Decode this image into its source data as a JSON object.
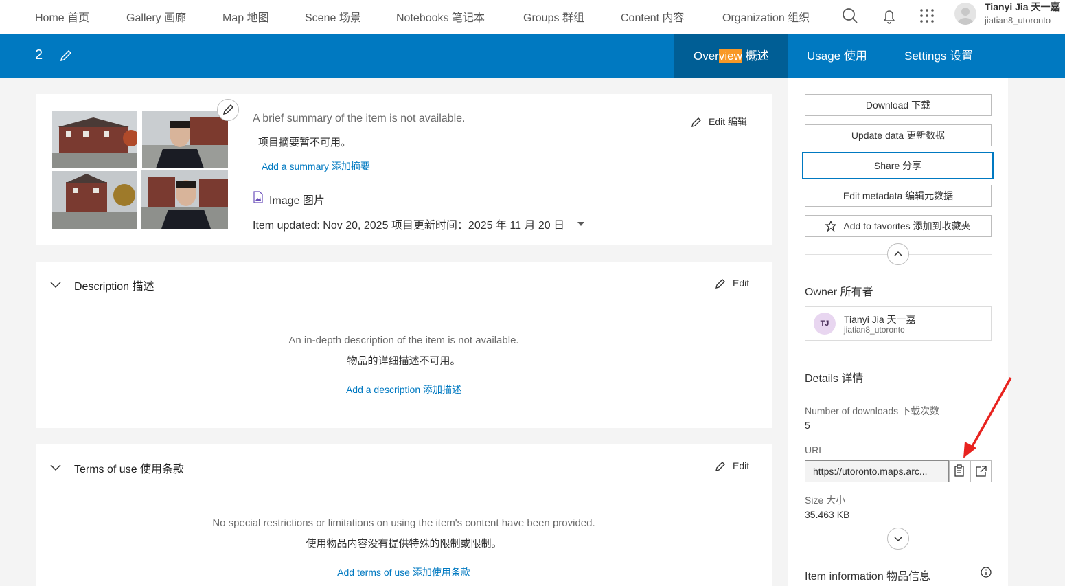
{
  "topnav": {
    "items": [
      {
        "label": "Home  首页"
      },
      {
        "label": "Gallery  画廊"
      },
      {
        "label": "Map  地图"
      },
      {
        "label": "Scene  场景"
      },
      {
        "label": "Notebooks  笔记本"
      },
      {
        "label": "Groups  群组"
      },
      {
        "label": "Content  内容"
      },
      {
        "label": "Organization  组织"
      }
    ],
    "icons": [
      "search-icon",
      "bell-icon",
      "apps-grid-icon"
    ],
    "user": {
      "name": "Tianyi Jia  天一嘉",
      "handle": "jiatian8_utoronto"
    }
  },
  "itembar": {
    "title": "2",
    "tabs": [
      {
        "label_a": "Over",
        "label_hl": "view",
        "label_b": "  概述"
      },
      {
        "label": "Usage  使用"
      },
      {
        "label": "Settings  设置"
      }
    ]
  },
  "summary_card": {
    "summary_en": "A brief summary of the item is not available.",
    "summary_zh": "项目摘要暂不可用。",
    "add_summary": "Add a summary  添加摘要",
    "item_type": "Image  图片",
    "updated": "Item updated: Nov 20, 2025  项目更新时间：2025 年 11 月 20 日",
    "edit_label": "Edit  编辑"
  },
  "description": {
    "title": "Description  描述",
    "edit": "Edit",
    "empty_en": "An in-depth description of the item is not available.",
    "empty_zh": "物品的详细描述不可用。",
    "add": "Add a description  添加描述"
  },
  "terms": {
    "title": "Terms of use  使用条款",
    "edit": "Edit",
    "empty_en": "No special restrictions or limitations on using the item's content have been provided.",
    "empty_zh": "使用物品内容没有提供特殊的限制或限制。",
    "add": "Add terms of use  添加使用条款"
  },
  "sidebar": {
    "buttons": {
      "download": "Download  下载",
      "update": "Update data  更新数据",
      "share": "Share  分享",
      "metadata": "Edit metadata  编辑元数据",
      "favorites": "Add to favorites  添加到收藏夹"
    },
    "owner_heading": "Owner  所有者",
    "owner": {
      "initials": "TJ",
      "name": "Tianyi Jia  天一嘉",
      "handle": "jiatian8_utoronto"
    },
    "details_heading": "Details  详情",
    "downloads_label": "Number of downloads   下载次数",
    "downloads_value": "5",
    "url_label": "URL",
    "url_value": "https://utoronto.maps.arc...",
    "size_label": "Size  大小",
    "size_value": "35.463 KB",
    "item_info_heading": "Item information  物品信息"
  },
  "colors": {
    "brand": "#0079c1",
    "active_tab": "#005e95",
    "highlight": "#f89927",
    "annotation_arrow": "#e8231f"
  }
}
